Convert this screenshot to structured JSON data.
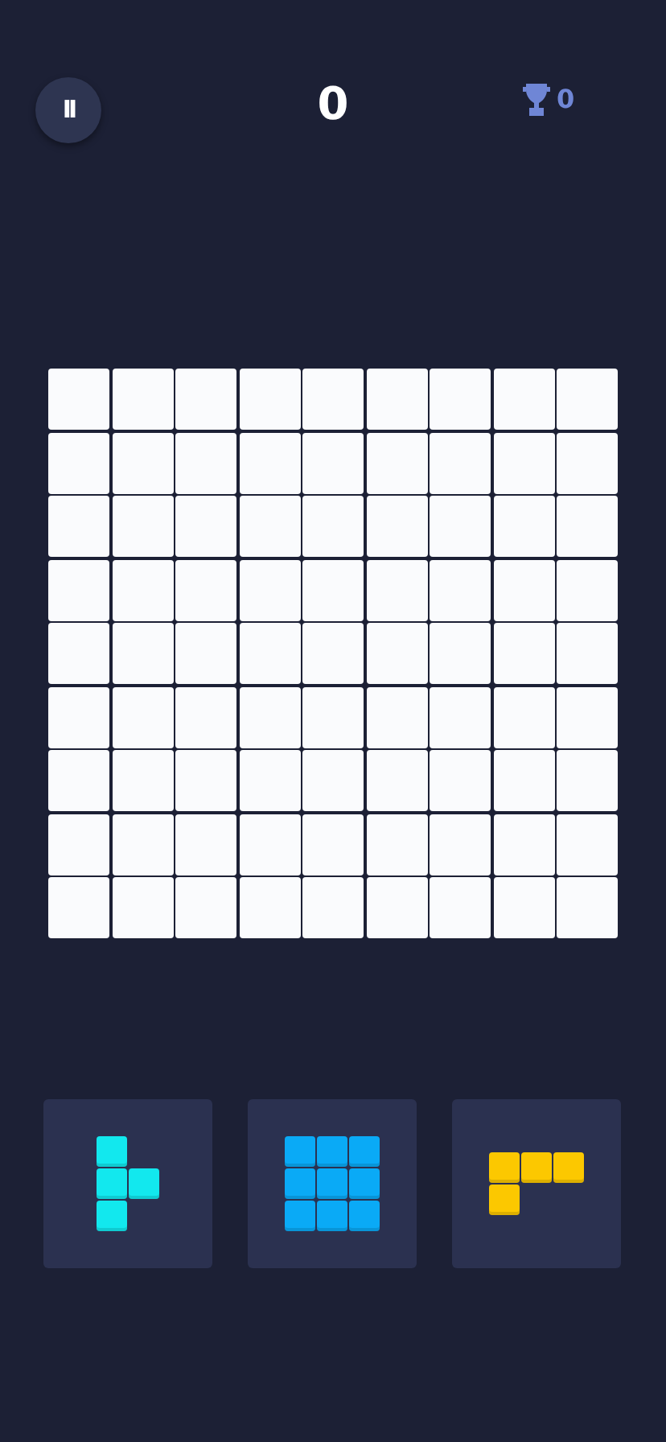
{
  "header": {
    "pause_icon": "II",
    "score": "0",
    "best_score": "0"
  },
  "board": {
    "rows": [
      [
        {
          "filled": false
        },
        {
          "filled": false
        },
        {
          "filled": false
        },
        {
          "filled": false
        },
        {
          "filled": false
        },
        {
          "filled": false
        },
        {
          "filled": false
        },
        {
          "filled": false
        },
        {
          "filled": false
        }
      ],
      [
        {
          "filled": false
        },
        {
          "filled": false
        },
        {
          "filled": false
        },
        {
          "filled": false
        },
        {
          "filled": false
        },
        {
          "filled": false
        },
        {
          "filled": false
        },
        {
          "filled": false
        },
        {
          "filled": false
        }
      ],
      [
        {
          "filled": false
        },
        {
          "filled": false
        },
        {
          "filled": false
        },
        {
          "filled": false
        },
        {
          "filled": false
        },
        {
          "filled": false
        },
        {
          "filled": false
        },
        {
          "filled": false
        },
        {
          "filled": false
        }
      ],
      [
        {
          "filled": false
        },
        {
          "filled": false
        },
        {
          "filled": false
        },
        {
          "filled": false
        },
        {
          "filled": false
        },
        {
          "filled": false
        },
        {
          "filled": false
        },
        {
          "filled": false
        },
        {
          "filled": false
        }
      ],
      [
        {
          "filled": false
        },
        {
          "filled": false
        },
        {
          "filled": false
        },
        {
          "filled": false
        },
        {
          "filled": false
        },
        {
          "filled": false
        },
        {
          "filled": false
        },
        {
          "filled": false
        },
        {
          "filled": false
        }
      ],
      [
        {
          "filled": false
        },
        {
          "filled": false
        },
        {
          "filled": false
        },
        {
          "filled": false
        },
        {
          "filled": false
        },
        {
          "filled": false
        },
        {
          "filled": false
        },
        {
          "filled": false
        },
        {
          "filled": false
        }
      ],
      [
        {
          "filled": false
        },
        {
          "filled": false
        },
        {
          "filled": false
        },
        {
          "filled": false
        },
        {
          "filled": false
        },
        {
          "filled": false
        },
        {
          "filled": false
        },
        {
          "filled": false
        },
        {
          "filled": false
        }
      ],
      [
        {
          "filled": false
        },
        {
          "filled": false
        },
        {
          "filled": false
        },
        {
          "filled": false
        },
        {
          "filled": false
        },
        {
          "filled": false
        },
        {
          "filled": false
        },
        {
          "filled": false
        },
        {
          "filled": false
        }
      ],
      [
        {
          "filled": false
        },
        {
          "filled": false
        },
        {
          "filled": false
        },
        {
          "filled": false
        },
        {
          "filled": false
        },
        {
          "filled": false
        },
        {
          "filled": false
        },
        {
          "filled": false
        },
        {
          "filled": false
        }
      ]
    ]
  },
  "pieces": [
    {
      "color": "#12e8ee",
      "cells": [
        [
          true,
          false
        ],
        [
          true,
          true
        ],
        [
          true,
          false
        ]
      ]
    },
    {
      "color": "#0aaaf6",
      "cells": [
        [
          true,
          true,
          true
        ],
        [
          true,
          true,
          true
        ],
        [
          true,
          true,
          true
        ]
      ]
    },
    {
      "color": "#fcc800",
      "cells": [
        [
          true,
          true,
          true
        ],
        [
          true,
          false,
          false
        ]
      ]
    }
  ]
}
